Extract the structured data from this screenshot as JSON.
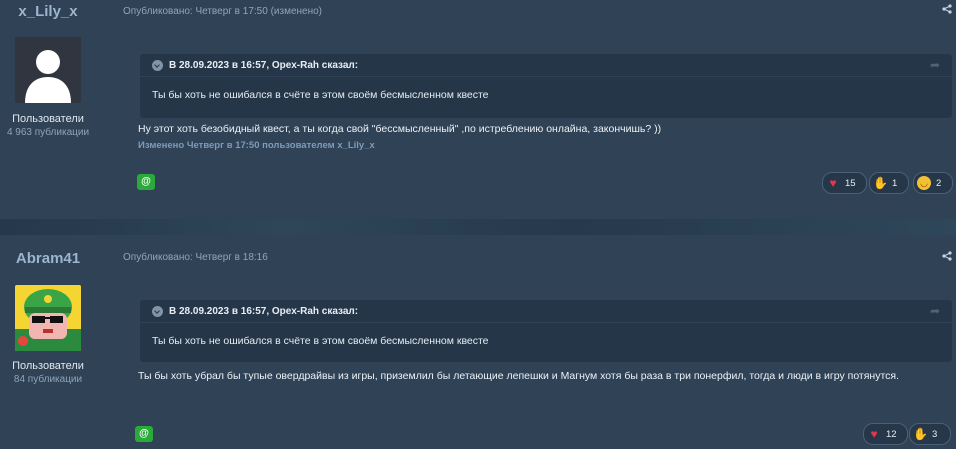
{
  "posts": [
    {
      "author": "x_Lily_x",
      "group": "Пользователи",
      "publications": "4 963 публикации",
      "meta": "Опубликовано: Четверг в 17:50 (изменено)",
      "quote_header": "В 28.09.2023 в 16:57, Орех-Rah сказал:",
      "quote_text": "Ты бы хоть не ошибался в счёте в этом своём бесмысленном квесте",
      "content": "Ну этот хоть безобидный квест, а ты когда свой \"бессмысленный\" ,по истреблению онлайна, закончишь? ))",
      "edited": "Изменено Четверг в 17:50 пользователем x_Lily_x",
      "reactions": [
        {
          "icon": "heart-icon",
          "count": "15"
        },
        {
          "icon": "clap-icon",
          "count": "1"
        },
        {
          "icon": "laugh-icon",
          "count": "2"
        }
      ]
    },
    {
      "author": "Abram41",
      "group": "Пользователи",
      "publications": "84 публикации",
      "meta": "Опубликовано: Четверг в 18:16",
      "quote_header": "В 28.09.2023 в 16:57, Орех-Rah сказал:",
      "quote_text": "Ты бы хоть не ошибался в счёте в этом своём бесмысленном квесте",
      "content": "Ты бы хоть убрал бы тупые овердрайвы из игры, приземлил бы летающие лепешки и Магнум хотя бы раза в три понерфил, тогда и люди в игру потянутся.",
      "reactions": [
        {
          "icon": "heart-icon",
          "count": "12"
        },
        {
          "icon": "clap-icon",
          "count": "3"
        }
      ]
    }
  ],
  "mention_label": "@",
  "colors": {
    "accent": "#2aaa3a",
    "heart": "#e2364a",
    "link": "#7e9bb8"
  }
}
